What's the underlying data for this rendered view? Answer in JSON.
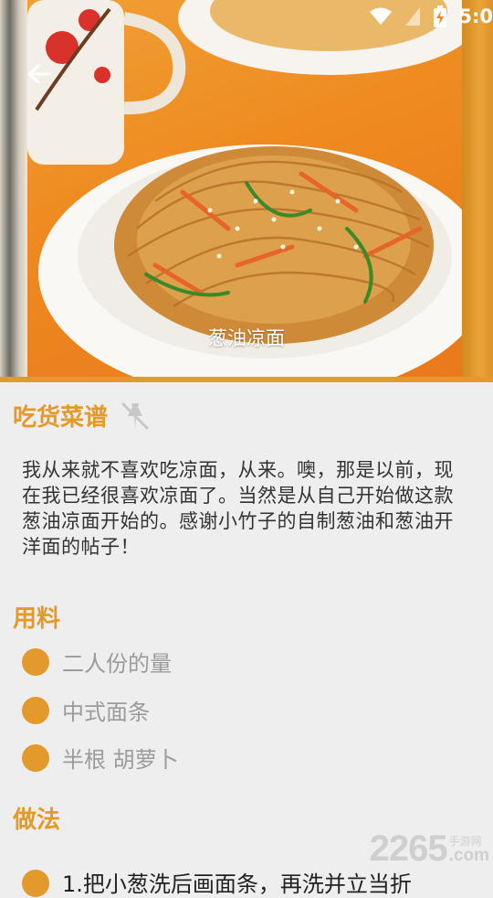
{
  "status_bar": {
    "time": "5:0"
  },
  "hero": {
    "caption": "葱油凉面"
  },
  "header": {
    "title": "吃货菜谱"
  },
  "intro": "我从来就不喜欢吃凉面，从来。噢，那是以前，现在我已经很喜欢凉面了。当然是从自己开始做这款葱油凉面开始的。感谢小竹子的自制葱油和葱油开洋面的帖子！",
  "ingredients": {
    "heading": "用料",
    "items": [
      "二人份的量",
      "中式面条",
      "半根 胡萝卜"
    ]
  },
  "steps": {
    "heading": "做法",
    "items": [
      "1.把小葱洗后画面条，再洗并立当折"
    ]
  },
  "watermark": {
    "number": "2265",
    "cn": "手游网",
    "com": ".com"
  },
  "colors": {
    "accent": "#e39a2a",
    "body_text": "#333333",
    "muted_text": "#9b9b9b"
  }
}
